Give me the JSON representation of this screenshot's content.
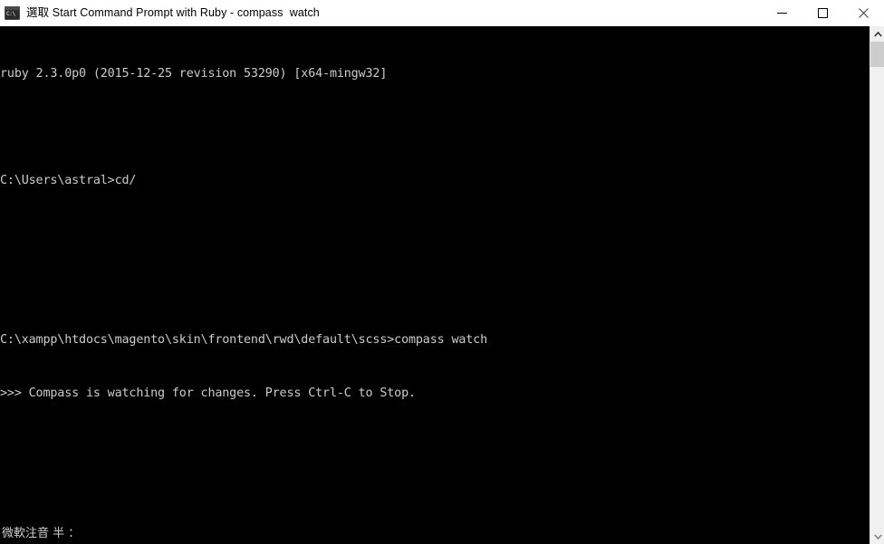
{
  "window": {
    "title_mode_prefix": "選取 ",
    "title": "選取 Start Command Prompt with Ruby - compass  watch",
    "app_name": "Start Command Prompt with Ruby",
    "command": "compass  watch",
    "icon_name": "cmd-console-icon",
    "icon_text": "C:\\",
    "colors": {
      "titlebar_bg": "#ffffff",
      "titlebar_fg": "#000000",
      "terminal_bg": "#000000",
      "terminal_fg": "#cccccc",
      "scrollbar_track": "#f0f0f0",
      "scrollbar_thumb": "#cdcdcd"
    }
  },
  "window_controls": {
    "minimize_label": "Minimize",
    "maximize_label": "Maximize",
    "close_label": "Close",
    "minimize_icon": "minimize-icon",
    "maximize_icon": "maximize-icon",
    "close_icon": "close-icon"
  },
  "terminal": {
    "lines": [
      "ruby 2.3.0p0 (2015-12-25 revision 53290) [x64-mingw32]",
      "",
      "C:\\Users\\astral>cd/",
      "",
      "",
      "C:\\xampp\\htdocs\\magento\\skin\\frontend\\rwd\\default\\scss>compass watch",
      ">>> Compass is watching for changes. Press Ctrl-C to Stop."
    ],
    "ruby_version": "2.3.0p0",
    "ruby_build_date": "2015-12-25",
    "ruby_revision": "53290",
    "ruby_platform": "x64-mingw32",
    "prompt_user_dir": "C:\\Users\\astral",
    "prompt_user_command": "cd/",
    "prompt_project_dir": "C:\\xampp\\htdocs\\magento\\skin\\frontend\\rwd\\default\\scss",
    "prompt_project_command": "compass watch",
    "status_message": ">>> Compass is watching for changes. Press Ctrl-C to Stop."
  },
  "ime": {
    "status_text": "微軟注音 半 ：",
    "engine": "微軟注音",
    "width_mode": "半",
    "punctuation_mode": "："
  },
  "scrollbar": {
    "up_arrow_icon": "chevron-up-icon",
    "down_arrow_icon": "chevron-down-icon",
    "thumb_name": "scrollbar-thumb"
  }
}
